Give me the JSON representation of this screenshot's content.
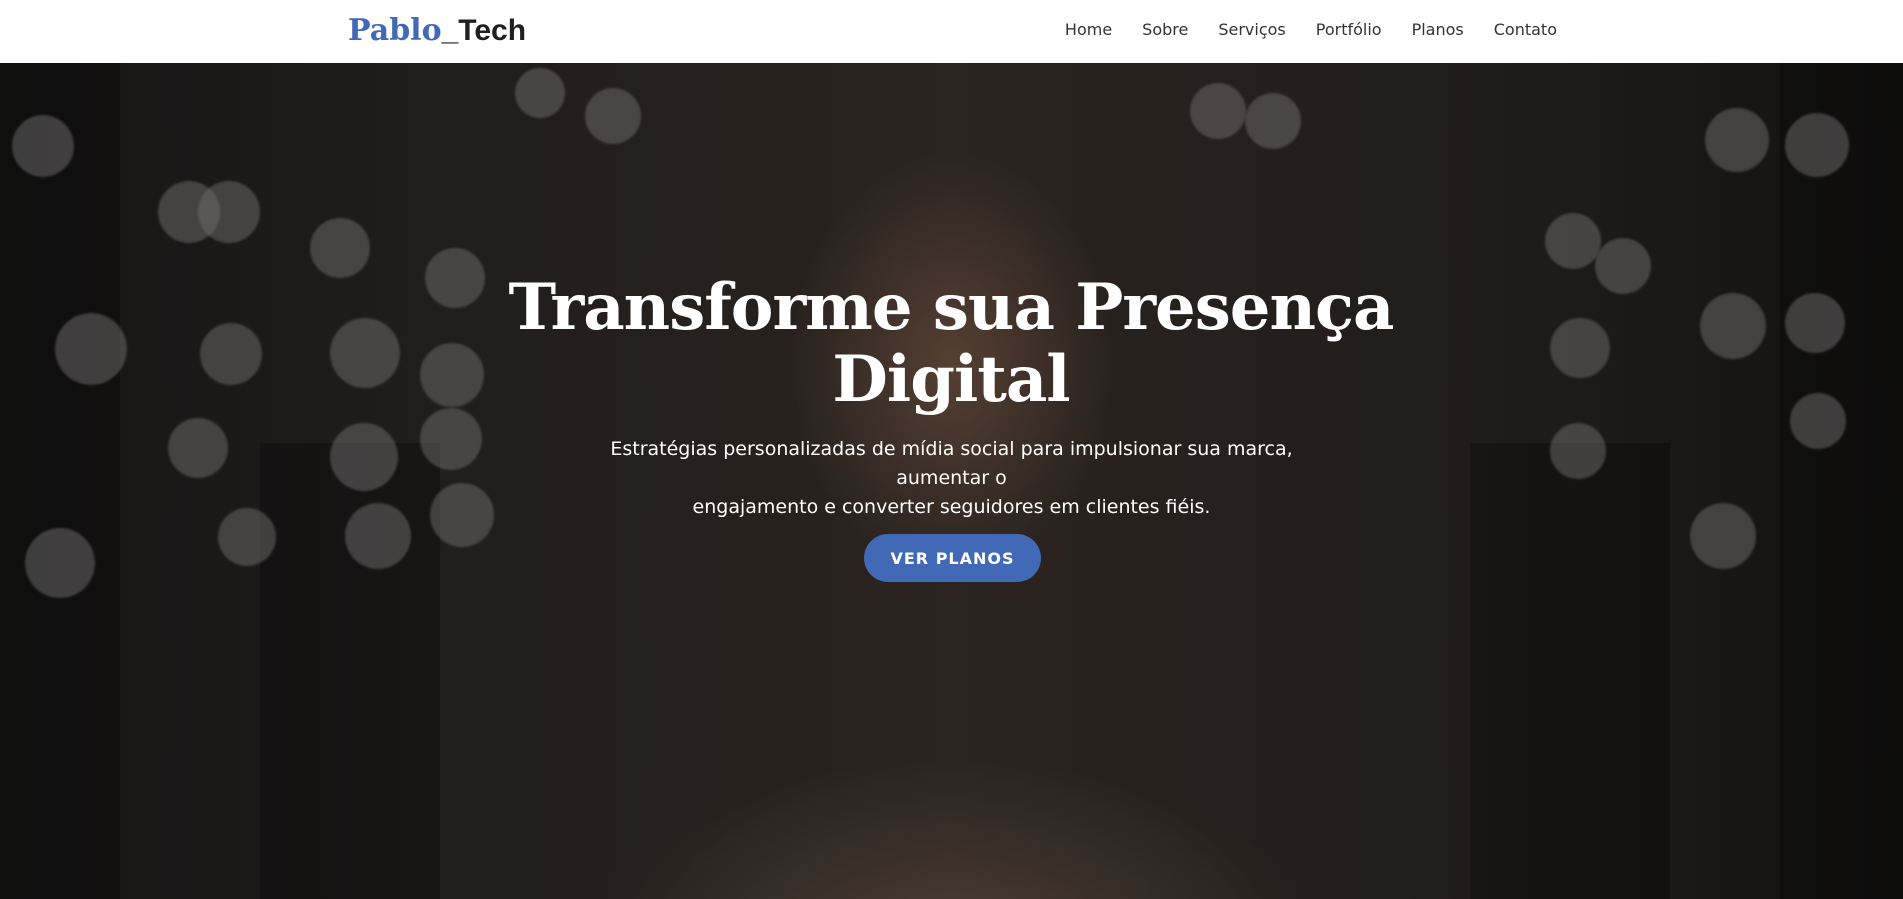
{
  "brand": {
    "first": "Pablo",
    "second": "_Tech",
    "first_color": "#4169b6",
    "second_color": "#1f1f1f"
  },
  "nav": {
    "items": [
      {
        "label": "Home"
      },
      {
        "label": "Sobre"
      },
      {
        "label": "Serviços"
      },
      {
        "label": "Portfólio"
      },
      {
        "label": "Planos"
      },
      {
        "label": "Contato"
      }
    ]
  },
  "hero": {
    "title_line1": "Transforme sua Presença",
    "title_line2": "Digital",
    "subtitle_line1": "Estratégias personalizadas de mídia social para impulsionar sua marca, aumentar o",
    "subtitle_line2": "engajamento e converter seguidores em clientes fiéis.",
    "cta_label": "VER PLANOS"
  },
  "colors": {
    "accent": "#4169b6",
    "navbar_bg": "#ffffff",
    "nav_text": "#333333"
  }
}
